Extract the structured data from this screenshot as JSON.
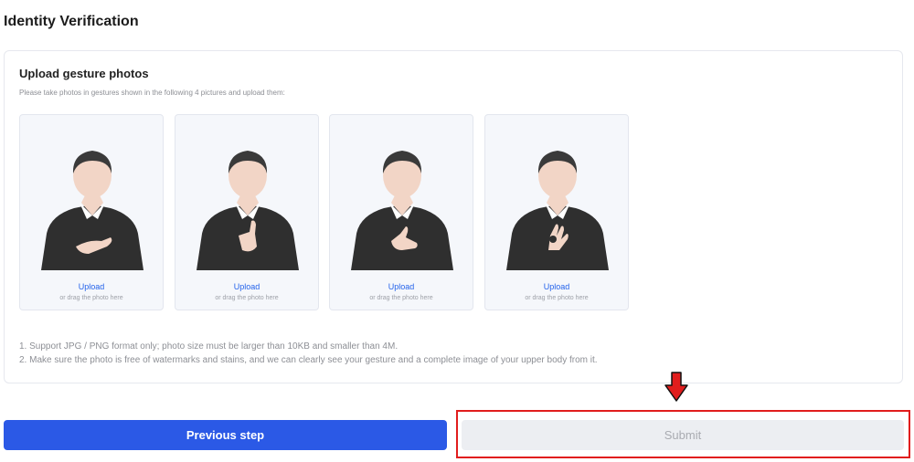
{
  "page": {
    "title": "Identity Verification"
  },
  "section": {
    "title": "Upload gesture photos",
    "instructions": "Please take photos in gestures shown in the following 4 pictures and upload them:"
  },
  "tiles": [
    {
      "gesture": "hand-on-chest",
      "upload_label": "Upload",
      "drag_hint": "or drag the photo here"
    },
    {
      "gesture": "thumbs-up",
      "upload_label": "Upload",
      "drag_hint": "or drag the photo here"
    },
    {
      "gesture": "shaka",
      "upload_label": "Upload",
      "drag_hint": "or drag the photo here"
    },
    {
      "gesture": "ok-sign",
      "upload_label": "Upload",
      "drag_hint": "or drag the photo here"
    }
  ],
  "notes": [
    "1. Support JPG / PNG format only; photo size must be larger than 10KB and smaller than 4M.",
    "2. Make sure the photo is free of watermarks and stains, and we can clearly see your gesture and a complete image of your upper body from it."
  ],
  "buttons": {
    "previous_label": "Previous step",
    "submit_label": "Submit"
  },
  "colors": {
    "primary": "#2b59e6",
    "link": "#2563eb",
    "annotation": "#e11d1d",
    "disabled_bg": "#eceef2"
  }
}
